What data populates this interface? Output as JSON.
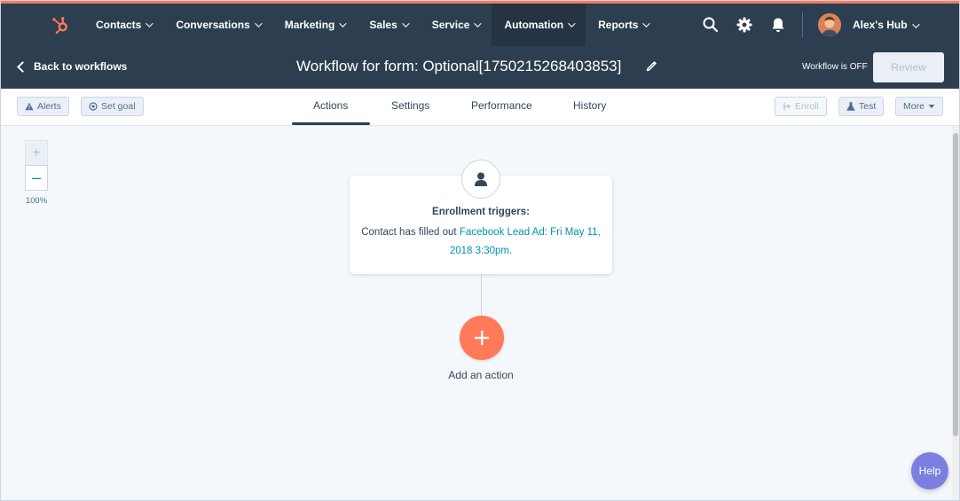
{
  "nav": {
    "items": [
      {
        "label": "Contacts"
      },
      {
        "label": "Conversations"
      },
      {
        "label": "Marketing"
      },
      {
        "label": "Sales"
      },
      {
        "label": "Service"
      },
      {
        "label": "Automation",
        "active": true
      },
      {
        "label": "Reports"
      }
    ],
    "account_label": "Alex's Hub",
    "icons": [
      "sprocket-logo-icon",
      "search-icon",
      "gear-icon",
      "bell-icon",
      "avatar"
    ]
  },
  "header": {
    "back_label": "Back to workflows",
    "title": "Workflow for form: Optional[1750215268403853]",
    "status": "Workflow is OFF",
    "review_label": "Review"
  },
  "toolbar": {
    "alerts_label": "Alerts",
    "set_goal_label": "Set goal",
    "tabs": [
      {
        "label": "Actions",
        "active": true
      },
      {
        "label": "Settings"
      },
      {
        "label": "Performance"
      },
      {
        "label": "History"
      }
    ],
    "enroll_label": "Enroll",
    "test_label": "Test",
    "more_label": "More"
  },
  "canvas": {
    "zoom_in": "+",
    "zoom_out": "–",
    "zoom_level": "100%",
    "trigger": {
      "title": "Enrollment triggers:",
      "text_prefix": "Contact has filled out ",
      "link_text": "Facebook Lead Ad: Fri May 11, 2018 3:30pm."
    },
    "add_action_label": "Add an action"
  },
  "help_label": "Help",
  "colors": {
    "nav_bg": "#2d3e50",
    "accent": "#ff7a59",
    "link": "#0091ae",
    "help": "#7b7fe0"
  }
}
